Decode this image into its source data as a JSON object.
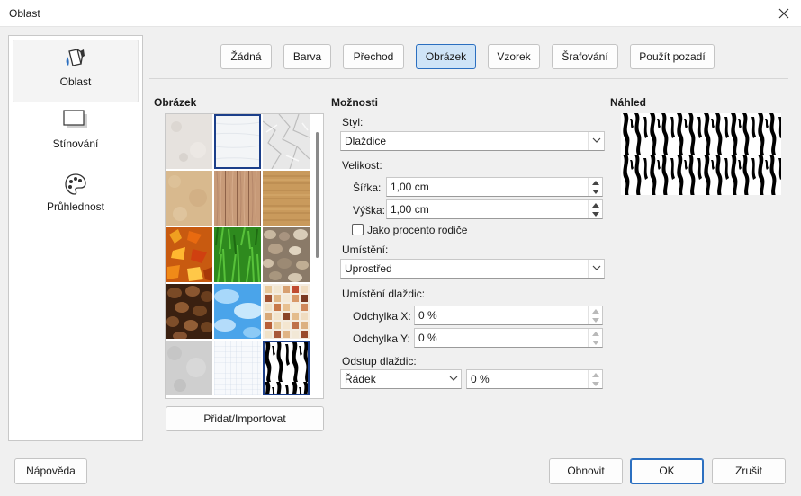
{
  "window": {
    "title": "Oblast"
  },
  "sidebar": {
    "items": [
      {
        "label": "Oblast",
        "icon": "area-fill-icon",
        "active": true
      },
      {
        "label": "Stínování",
        "icon": "shadow-icon",
        "active": false
      },
      {
        "label": "Průhlednost",
        "icon": "palette-icon",
        "active": false
      }
    ]
  },
  "fill_tabs": [
    {
      "label": "Žádná",
      "selected": false
    },
    {
      "label": "Barva",
      "selected": false
    },
    {
      "label": "Přechod",
      "selected": false
    },
    {
      "label": "Obrázek",
      "selected": true
    },
    {
      "label": "Vzorek",
      "selected": false
    },
    {
      "label": "Šrafování",
      "selected": false
    },
    {
      "label": "Použít pozadí",
      "selected": false
    }
  ],
  "image_section": {
    "heading": "Obrázek",
    "tiles": [
      "light-plaster",
      "white-paper",
      "crumpled-paper",
      "sand",
      "wood-planks",
      "wood",
      "autumn-leaves",
      "grass",
      "pebbles",
      "coffee-beans",
      "sky-clouds",
      "color-squares",
      "concrete",
      "graph-paper",
      "zebra"
    ],
    "selected_tile": "zebra",
    "add_button": "Přidat/Importovat"
  },
  "options": {
    "heading": "Možnosti",
    "style_label": "Styl:",
    "style_value": "Dlaždice",
    "size_label": "Velikost:",
    "width_label": "Šířka:",
    "width_value": "1,00 cm",
    "height_label": "Výška:",
    "height_value": "1,00 cm",
    "relative_label": "Jako procento rodiče",
    "relative_checked": false,
    "position_label": "Umístění:",
    "position_value": "Uprostřed",
    "tile_position_label": "Umístění dlaždic:",
    "offset_x_label": "Odchylka X:",
    "offset_x_value": "0 %",
    "offset_y_label": "Odchylka Y:",
    "offset_y_value": "0 %",
    "tile_offset_label": "Odstup dlaždic:",
    "tile_offset_type": "Řádek",
    "tile_offset_value": "0 %"
  },
  "preview": {
    "heading": "Náhled"
  },
  "footer": {
    "help": "Nápověda",
    "reset": "Obnovit",
    "ok": "OK",
    "cancel": "Zrušit"
  },
  "colors": {
    "accent": "#2b6fc0",
    "selected_tab_bg": "#cfe4f7",
    "background": "#f0f0f0"
  }
}
